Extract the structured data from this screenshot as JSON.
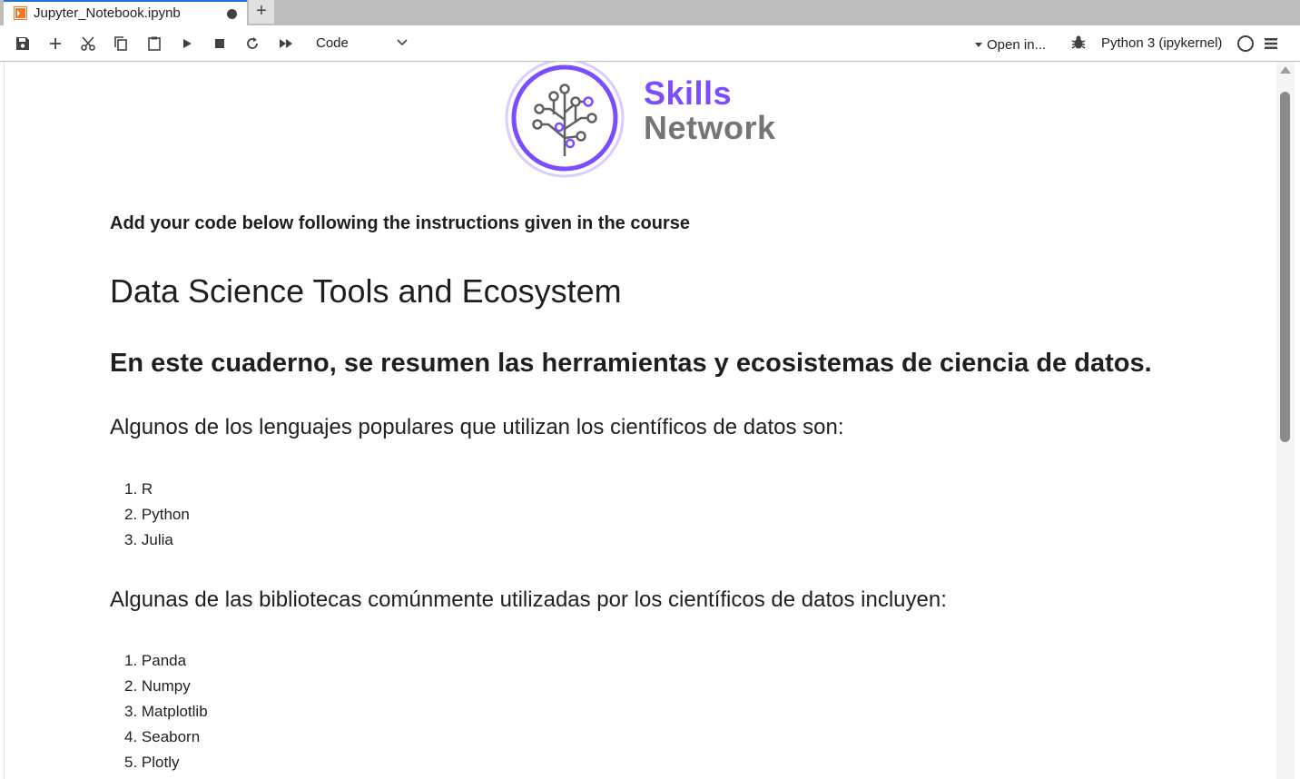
{
  "tab": {
    "title": "Jupyter_Notebook.ipynb",
    "new_tab": "+"
  },
  "toolbar": {
    "icons": [
      "save-icon",
      "add-cell-icon",
      "cut-icon",
      "copy-icon",
      "paste-icon",
      "run-icon",
      "stop-icon",
      "restart-icon",
      "run-all-icon"
    ],
    "cell_type": "Code",
    "open_in": "Open in...",
    "kernel": "Python 3 (ipykernel)"
  },
  "logo": {
    "line1": "Skills",
    "line2": "Network",
    "colors": {
      "accent": "#7c4dff",
      "gray": "#757575"
    }
  },
  "content": {
    "instruction": "Add your code below following the instructions given in the course",
    "title": "Data Science Tools and Ecosystem",
    "intro": "En este cuaderno, se resumen las herramientas y ecosistemas de ciencia de datos.",
    "languages_heading": "Algunos de los lenguajes populares que utilizan los científicos de datos son:",
    "languages": [
      "1. R",
      "2. Python",
      "3. Julia"
    ],
    "libraries_heading": "Algunas de las bibliotecas comúnmente utilizadas por los científicos de datos incluyen:",
    "libraries": [
      "1. Panda",
      "2. Numpy",
      "3. Matplotlib",
      "4. Seaborn",
      "5. Plotly"
    ]
  }
}
